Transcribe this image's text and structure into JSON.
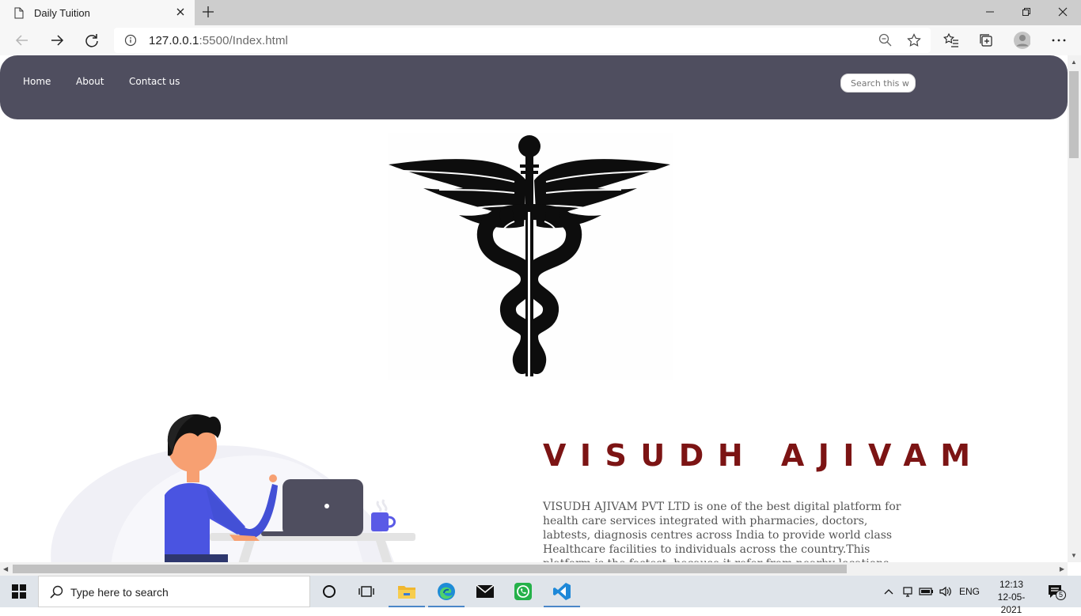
{
  "browser": {
    "tab_title": "Daily Tuition",
    "url_host": "127.0.0.1",
    "url_path": ":5500/Index.html"
  },
  "site": {
    "nav_items": [
      "Home",
      "About",
      "Contact us"
    ],
    "search_placeholder": "Search this w",
    "brand_title": "VISUDH AJIVAM",
    "about_text": "VISUDH AJIVAM PVT LTD is one of the best digital platform for health care services integrated with pharmacies, doctors, labtests, diagnosis centres across India to provide world class Healthcare facilities to individuals across the country.This platform is the fastest, because it refer from nearby locations."
  },
  "taskbar": {
    "search_placeholder": "Type here to search",
    "language": "ENG",
    "time": "12:13",
    "date": "12-05-2021",
    "notification_count": "5"
  },
  "colors": {
    "nav_bg": "#4f4e5f",
    "brand_title": "#7c1414",
    "illustration_accent": "#4a54e1"
  }
}
